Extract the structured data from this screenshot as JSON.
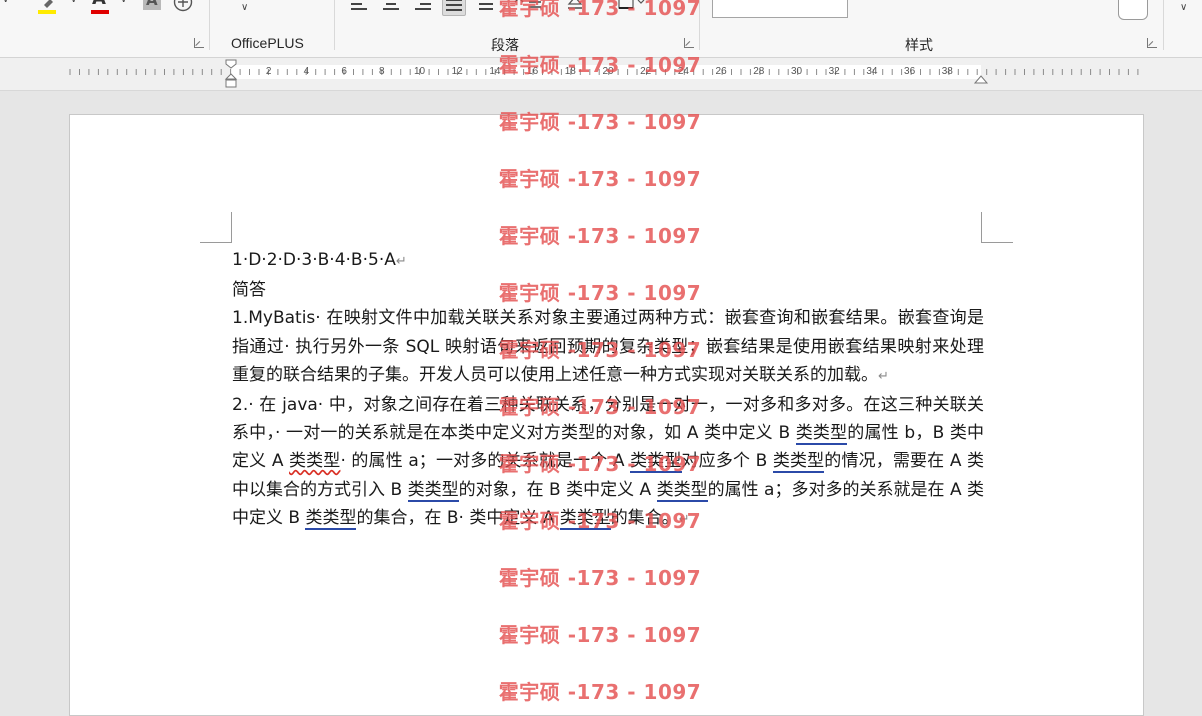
{
  "ribbon": {
    "groups": [
      {
        "label": "OfficePLUS"
      },
      {
        "label": "段落"
      },
      {
        "label": "样式"
      }
    ],
    "font_color_letter": "A",
    "shade_letter": "A",
    "colors": {
      "highlight": "#ffeb00",
      "font": "#e00000",
      "accent": "#2b4aa8"
    }
  },
  "ruler": {
    "numbers": [
      "2",
      "4",
      "6",
      "8",
      "10",
      "12",
      "14",
      "16",
      "18",
      "20",
      "22",
      "24",
      "26",
      "28",
      "30",
      "32",
      "34",
      "36",
      "38"
    ]
  },
  "document": {
    "answer_line": "1·D·2·D·3·B·4·B·5·A",
    "subheading": "简答",
    "para1": {
      "a": "1.MyBatis· 在映射文件中加载关联关系对象主要通过两种方式：嵌套查询和嵌套结果。嵌套查询是指通过· 执行另外一条 SQL 映射语句来返回预期的复杂类型；嵌套结果是使用嵌套结果映射来处理重复的联合结果的子集。开发人员可以使用上述任意一种方式实现对关联关系的加载。"
    },
    "para2": {
      "a": "2.· 在 java· 中，对象之间存在着三种关联关系，分别是一对一，一对多和多对多。在这三种关联关系中，· 一对一的关系就是在本类中定义对方类型的对象，如 A 类中定义 B ",
      "u1": "类类型",
      "b": "的属性 b，B 类中定义 A ",
      "u2": "类类型",
      "c": "· 的属性 a；一对多的关系就是一个 A ",
      "u3": "类类型",
      "d": "对应多个 B ",
      "u4": "类类型",
      "e": "的情况，需要在 A 类中以集合的方式引入 B ",
      "u5": "类类型",
      "f": "的对象，在 B 类中定义 A ",
      "u6": "类类型",
      "g": "的属性 a；多对多的关系就是在 A 类中定义 B ",
      "u7": "类类型",
      "h": "的集合，在 B· 类中定义 A ",
      "u8": "类类型",
      "i": "的集合。"
    },
    "paragraph_mark": "↵"
  },
  "watermark": {
    "text": "霍宇硕 -173 - 1097"
  }
}
